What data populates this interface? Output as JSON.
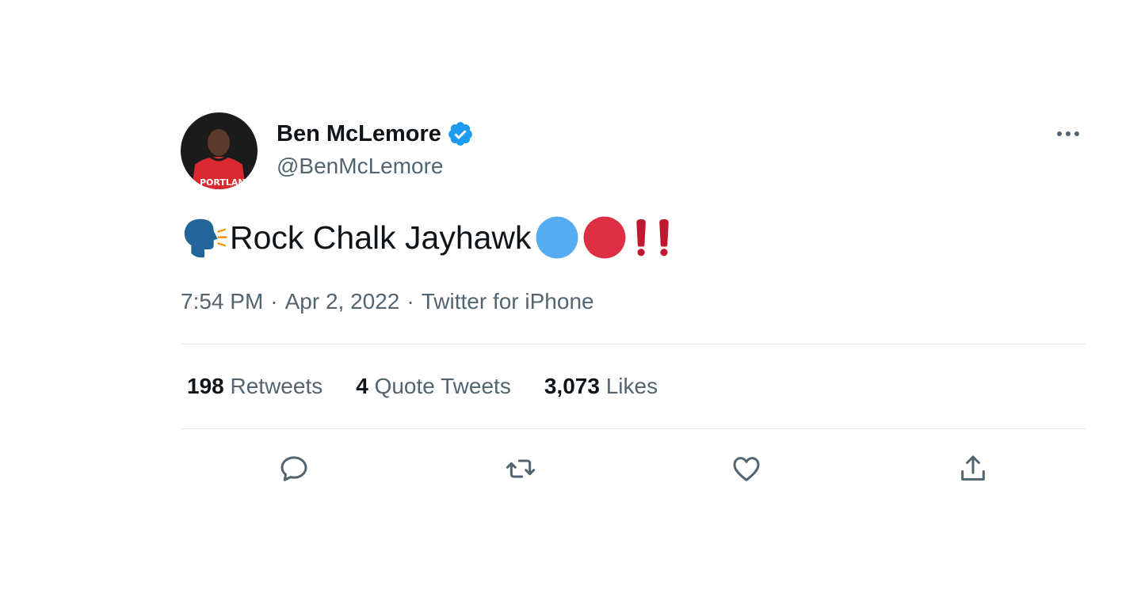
{
  "author": {
    "display_name": "Ben McLemore",
    "handle": "@BenMcLemore",
    "verified": true,
    "verified_color": "#1d9bf0"
  },
  "tweet": {
    "text": "Rock Chalk Jayhawk",
    "emojis": [
      "speaking-head-icon",
      "blue-circle-icon",
      "red-circle-icon",
      "double-exclamation-icon"
    ]
  },
  "meta": {
    "time": "7:54 PM",
    "date": "Apr 2, 2022",
    "source": "Twitter for iPhone",
    "separator": "·"
  },
  "stats": {
    "retweets_count": "198",
    "retweets_label": "Retweets",
    "quotes_count": "4",
    "quotes_label": "Quote Tweets",
    "likes_count": "3,073",
    "likes_label": "Likes"
  },
  "actions": [
    "reply-icon",
    "retweet-icon",
    "like-icon",
    "share-icon"
  ],
  "colors": {
    "text_primary": "#0f1419",
    "text_secondary": "#536471",
    "divider": "#e3e8ec",
    "blue_circle": "#55acee",
    "red_circle": "#dd2e44"
  }
}
